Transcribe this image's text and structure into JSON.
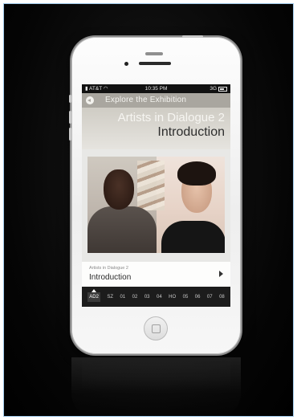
{
  "status_bar": {
    "carrier": "AT&T",
    "time": "10:35 PM",
    "network": "3G"
  },
  "nav": {
    "title": "Explore the Exhibition",
    "back_icon": "back-arrow-icon"
  },
  "hero": {
    "subtitle": "Artists in Dialogue 2",
    "heading": "Introduction"
  },
  "info_card": {
    "small_label": "Artists in Dialogue 2",
    "title": "Introduction",
    "arrow_icon": "chevron-right-icon"
  },
  "tabs": [
    {
      "label": "AD2",
      "active": true
    },
    {
      "label": "SZ"
    },
    {
      "label": "01"
    },
    {
      "label": "02"
    },
    {
      "label": "03"
    },
    {
      "label": "04"
    },
    {
      "label": "HO"
    },
    {
      "label": "05"
    },
    {
      "label": "06"
    },
    {
      "label": "07"
    },
    {
      "label": "08"
    }
  ],
  "colors": {
    "nav_bg": "#a9a69f",
    "tabbar_bg": "#1c1c1c",
    "background": "#000000"
  }
}
